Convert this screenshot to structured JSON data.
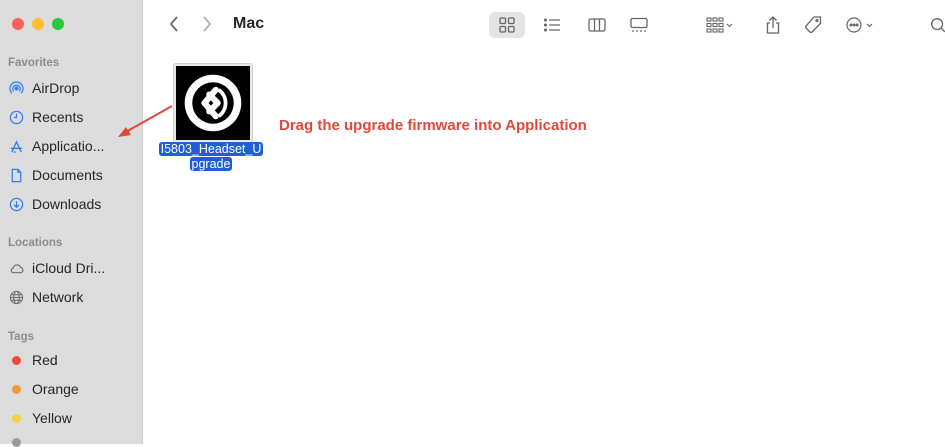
{
  "window": {
    "title": "Mac"
  },
  "sidebar": {
    "favorites_title": "Favorites",
    "favorites": [
      {
        "label": "AirDrop",
        "icon": "airdrop-icon"
      },
      {
        "label": "Recents",
        "icon": "clock-icon"
      },
      {
        "label": "Applicatio...",
        "icon": "applications-icon"
      },
      {
        "label": "Documents",
        "icon": "document-icon"
      },
      {
        "label": "Downloads",
        "icon": "download-icon"
      }
    ],
    "locations_title": "Locations",
    "locations": [
      {
        "label": "iCloud Dri...",
        "icon": "cloud-icon"
      },
      {
        "label": "Network",
        "icon": "network-icon"
      }
    ],
    "tags_title": "Tags",
    "tags": [
      {
        "label": "Red",
        "color": "#eb4d3d"
      },
      {
        "label": "Orange",
        "color": "#f09a37"
      },
      {
        "label": "Yellow",
        "color": "#f7cd46"
      }
    ]
  },
  "content": {
    "file": {
      "name_line1": "I5803_Headset_U",
      "name_line2": "pgrade"
    },
    "annotation": "Drag the upgrade firmware into Application"
  },
  "colors": {
    "accent": "#2f7cf6",
    "selection": "#1f5fd6",
    "annotation": "#e2483a"
  }
}
